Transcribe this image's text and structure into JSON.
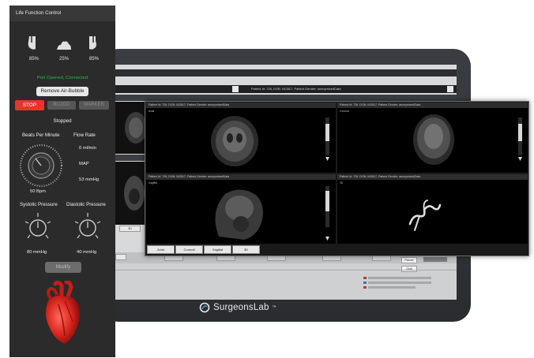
{
  "panel": {
    "title": "Life Function Control",
    "monitors": [
      {
        "icon": "lung-left-icon",
        "percent": "85%"
      },
      {
        "icon": "heart-tissue-icon",
        "percent": "25%"
      },
      {
        "icon": "lung-right-icon",
        "percent": "85%"
      }
    ],
    "status": "Port Opened, Connected",
    "remove_bubble_label": "Remove Air-Bubble",
    "modes": {
      "stop": "STOP",
      "blood": "BLOOD",
      "marker": "MARKER"
    },
    "pump_state": "Stopped",
    "beats_label": "Beats Per Minute",
    "flow_label": "Flow Rate",
    "flow_value": "0  ml/min",
    "map_label": "MAP",
    "map_value": "53 mmHg",
    "beats_value": "50 Bpm",
    "systolic_label": "Systolic Pressure",
    "diastolic_label": "Diastolic Pressure",
    "systolic_value": "80 mmHg",
    "diastolic_value": "40 mmHg",
    "modify_label": "Modify",
    "colors": {
      "stop": "#e8352b",
      "status": "#2db84b",
      "panel": "#2b2b2b"
    }
  },
  "viewer": {
    "title": "Patient Id: 726, DOB: 042817, Patient Gender: anonymizedData",
    "buttons": [
      "Axial",
      "Coronal",
      "Sagittal",
      "3D"
    ],
    "viewports": [
      {
        "label": "Axial"
      },
      {
        "label": "Coronal"
      },
      {
        "label": "Sagittal"
      },
      {
        "label": "3D"
      }
    ]
  },
  "tablet": {
    "brand": "SurgeonsLab",
    "brand_mark": "™",
    "mini_button": "3D",
    "buttons": [
      "Pause",
      "Quit"
    ]
  }
}
